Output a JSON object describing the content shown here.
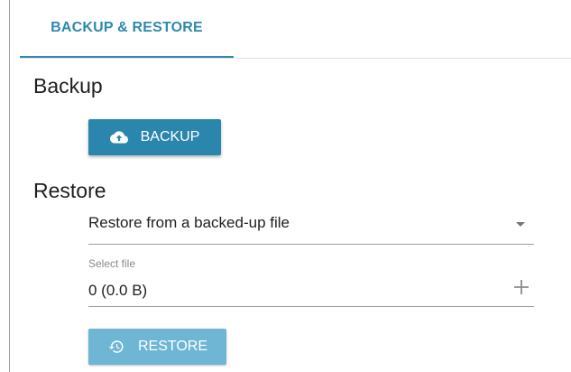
{
  "tabs": [
    {
      "label": "BACKUP & RESTORE"
    }
  ],
  "backup": {
    "title": "Backup",
    "button_label": "BACKUP",
    "button_icon": "cloud-upload-icon"
  },
  "restore": {
    "title": "Restore",
    "source_select": {
      "value": "Restore from a backed-up file",
      "icon": "dropdown-arrow-icon"
    },
    "file_field": {
      "label": "Select file",
      "value": "0 (0.0 B)",
      "icon": "plus-icon"
    },
    "button_label": "RESTORE",
    "button_icon": "history-icon"
  },
  "colors": {
    "accent": "#2f89ae",
    "button_primary": "#2a86ac",
    "button_disabled": "#6eb6d3"
  }
}
